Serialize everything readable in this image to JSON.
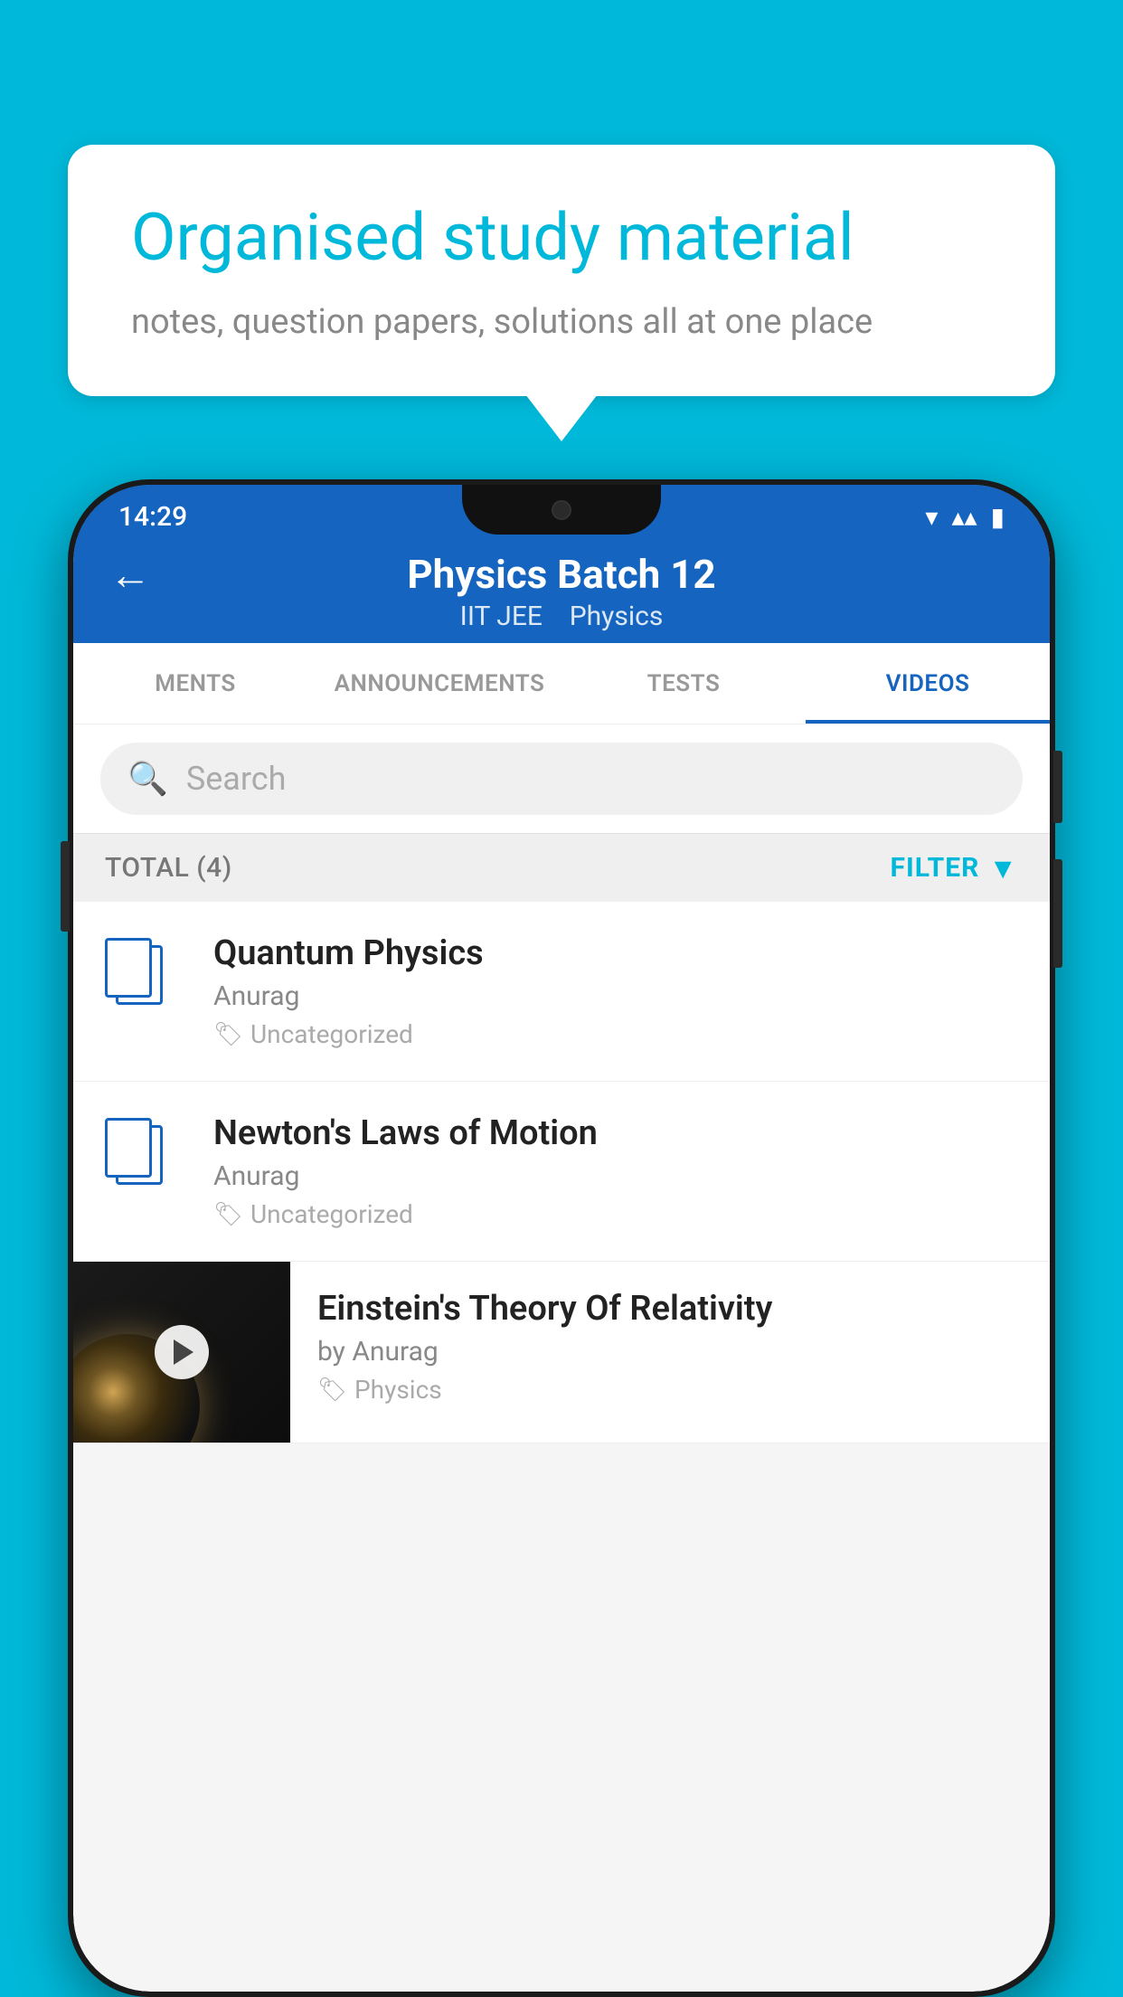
{
  "background_color": "#00B8D9",
  "speech_bubble": {
    "title": "Organised study material",
    "subtitle": "notes, question papers, solutions all at one place"
  },
  "phone": {
    "status_bar": {
      "time": "14:29",
      "icons": [
        "wifi",
        "signal",
        "battery"
      ]
    },
    "app_bar": {
      "back_label": "←",
      "title": "Physics Batch 12",
      "subtitle_parts": [
        "IIT JEE",
        "Physics"
      ]
    },
    "tabs": [
      {
        "label": "MENTS",
        "active": false
      },
      {
        "label": "ANNOUNCEMENTS",
        "active": false
      },
      {
        "label": "TESTS",
        "active": false
      },
      {
        "label": "VIDEOS",
        "active": true
      }
    ],
    "search": {
      "placeholder": "Search"
    },
    "filter_bar": {
      "total_label": "TOTAL (4)",
      "filter_label": "FILTER"
    },
    "videos": [
      {
        "title": "Quantum Physics",
        "author": "Anurag",
        "tag": "Uncategorized",
        "has_thumbnail": false
      },
      {
        "title": "Newton's Laws of Motion",
        "author": "Anurag",
        "tag": "Uncategorized",
        "has_thumbnail": false
      },
      {
        "title": "Einstein's Theory Of Relativity",
        "author": "by Anurag",
        "tag": "Physics",
        "has_thumbnail": true
      }
    ]
  }
}
